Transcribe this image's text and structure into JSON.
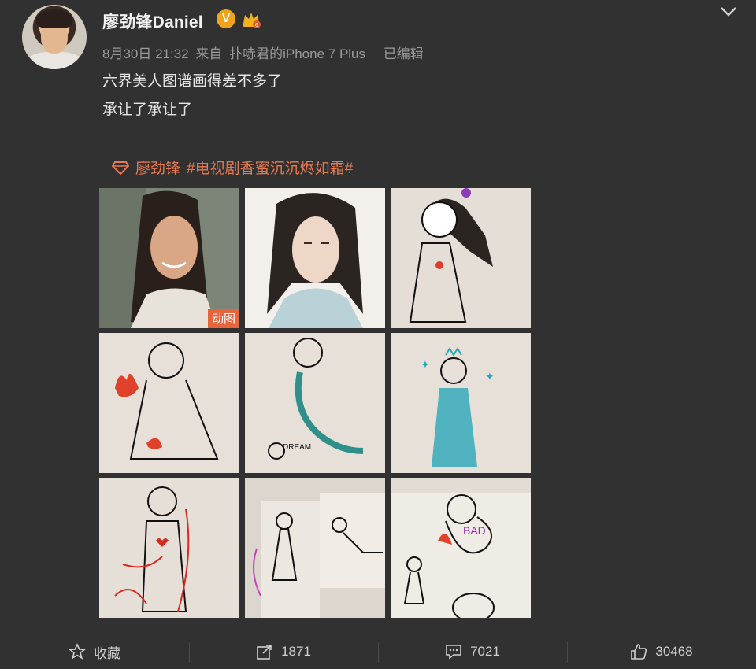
{
  "post": {
    "username": "廖劲锋Daniel",
    "verified_badge": "V",
    "date": "8月30日 21:32",
    "source_prefix": "来自",
    "source": "扑哧君的iPhone 7 Plus",
    "edited": "已编辑",
    "lines": [
      "六界美人图谱画得差不多了",
      "承让了承让了"
    ],
    "topic_person": "廖劲锋",
    "topic_tag": "#电视剧香蜜沉沉烬如霜#",
    "gif_badge": "动图"
  },
  "images": [
    {
      "name": "photo-actor-still",
      "type": "photo"
    },
    {
      "name": "illustration-actor",
      "type": "illustration"
    },
    {
      "name": "drawing-girl-flower",
      "type": "drawing"
    },
    {
      "name": "drawing-fire-figure",
      "type": "drawing"
    },
    {
      "name": "drawing-mermaid-dragon",
      "type": "drawing"
    },
    {
      "name": "drawing-blue-princess",
      "type": "drawing"
    },
    {
      "name": "drawing-red-figure",
      "type": "drawing"
    },
    {
      "name": "drawing-two-figures",
      "type": "drawing"
    },
    {
      "name": "drawing-bad-bird",
      "type": "drawing"
    }
  ],
  "drawing_texts": {
    "dream": "DREAM",
    "bad": "BAD"
  },
  "footer": {
    "favorite_label": "收藏",
    "repost_count": "1871",
    "comment_count": "7021",
    "like_count": "30468"
  },
  "icons": {
    "favorite": "star-outline-icon",
    "repost": "share-arrow-icon",
    "comment": "comment-bubble-icon",
    "like": "thumbs-up-icon",
    "collapse": "chevron-down-icon"
  },
  "colors": {
    "background": "#313131",
    "topic": "#e87a52",
    "badge": "#f2a21b",
    "gif_badge": "#e8643c"
  }
}
